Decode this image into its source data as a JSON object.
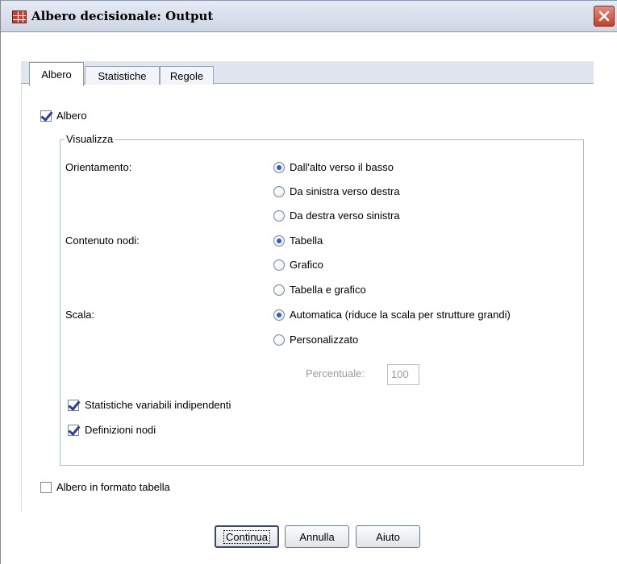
{
  "window": {
    "title": "Albero decisionale: Output"
  },
  "tabs": [
    {
      "label": "Albero",
      "active": true
    },
    {
      "label": "Statistiche",
      "active": false
    },
    {
      "label": "Regole",
      "active": false
    }
  ],
  "tree_checkbox": {
    "label": "Albero",
    "checked": true
  },
  "display_group": {
    "title": "Visualizza",
    "orientation": {
      "label": "Orientamento:",
      "options": [
        {
          "label": "Dall'alto verso il basso",
          "checked": true
        },
        {
          "label": "Da sinistra verso destra",
          "checked": false
        },
        {
          "label": "Da destra verso sinistra",
          "checked": false
        }
      ]
    },
    "node_content": {
      "label": "Contenuto nodi:",
      "options": [
        {
          "label": "Tabella",
          "checked": true
        },
        {
          "label": "Grafico",
          "checked": false
        },
        {
          "label": "Tabella e grafico",
          "checked": false
        }
      ]
    },
    "scale": {
      "label": "Scala:",
      "options": [
        {
          "label": "Automatica (riduce la scala per strutture grandi)",
          "checked": true
        },
        {
          "label": "Personalizzato",
          "checked": false
        }
      ],
      "percent_label": "Percentuale:",
      "percent_value": "100"
    },
    "independent_stats": {
      "label": "Statistiche variabili indipendenti",
      "checked": true
    },
    "node_definitions": {
      "label": "Definizioni nodi",
      "checked": true
    }
  },
  "table_format": {
    "label": "Albero in formato tabella",
    "checked": false
  },
  "buttons": {
    "continue": "Continua",
    "cancel": "Annulla",
    "help": "Aiuto"
  },
  "icons": {
    "app": "grid-table-icon",
    "close": "close-icon"
  }
}
